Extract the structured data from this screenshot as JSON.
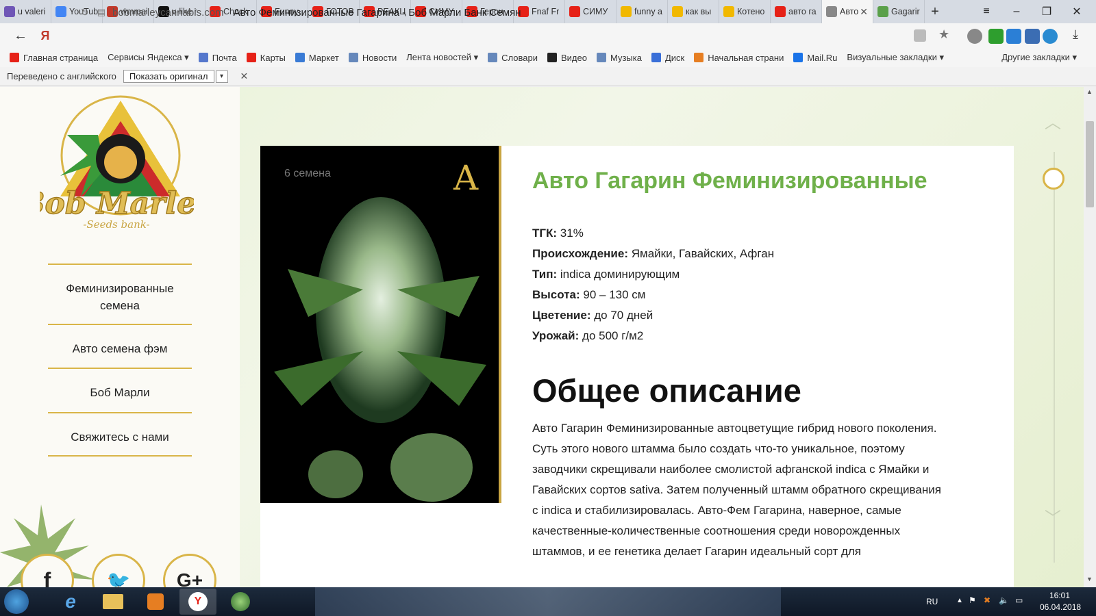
{
  "tabs": [
    {
      "label": "u valeri",
      "color": "#6f56b6"
    },
    {
      "label": "YouTub",
      "color": "#4285f4"
    },
    {
      "label": "wmmai",
      "color": "#c0392b"
    },
    {
      "label": "v-like.r",
      "color": "#111111"
    },
    {
      "label": "Chuck",
      "color": "#e62117"
    },
    {
      "label": "Funny",
      "color": "#e62117"
    },
    {
      "label": "ГОТОВ",
      "color": "#e62117"
    },
    {
      "label": "РЕАКЦ",
      "color": "#e62117"
    },
    {
      "label": "СИМУ",
      "color": "#e62117"
    },
    {
      "label": "Герои",
      "color": "#e62117"
    },
    {
      "label": "Fnaf Fr",
      "color": "#e62117"
    },
    {
      "label": "СИМУ",
      "color": "#e62117"
    },
    {
      "label": "funny a",
      "color": "#f1b800"
    },
    {
      "label": "как вы",
      "color": "#f1b800"
    },
    {
      "label": "Котено",
      "color": "#f1b800"
    },
    {
      "label": "авто га",
      "color": "#e62117"
    },
    {
      "label": "Авто",
      "color": "#888888",
      "active": true
    },
    {
      "label": "Gagarir",
      "color": "#5aa04a"
    }
  ],
  "address": {
    "domain": "bobmarleycannabis.com",
    "title": "Авто Феминизированные Гагарина - Боб Марли Банк Семян"
  },
  "bookmarks": [
    {
      "label": "Главная страница",
      "color": "#e62117"
    },
    {
      "label": "Сервисы Яндекса ▾",
      "color": "#f5f5f5"
    },
    {
      "label": "Почта",
      "color": "#5577cc"
    },
    {
      "label": "Карты",
      "color": "#e62117"
    },
    {
      "label": "Маркет",
      "color": "#3a7bd5"
    },
    {
      "label": "Новости",
      "color": "#6688bb"
    },
    {
      "label": "Лента новостей ▾",
      "color": "#f5f5f5"
    },
    {
      "label": "Словари",
      "color": "#6688bb"
    },
    {
      "label": "Видео",
      "color": "#222222"
    },
    {
      "label": "Музыка",
      "color": "#6688bb"
    },
    {
      "label": "Диск",
      "color": "#3a6fd8"
    },
    {
      "label": "Начальная страни",
      "color": "#e67e22"
    },
    {
      "label": "Mail.Ru",
      "color": "#1a73e8"
    },
    {
      "label": "Визуальные закладки ▾",
      "color": "#f5f5f5"
    }
  ],
  "bookmarks_other": "Другие закладки ▾",
  "translate": {
    "text": "Переведено с английского",
    "button": "Показать оригинал"
  },
  "sidebar": {
    "nav": [
      {
        "label": "Феминизированные семена"
      },
      {
        "label": "Авто семена фэм"
      },
      {
        "label": "Боб Марли"
      },
      {
        "label": "Свяжитесь с нами"
      }
    ],
    "social": [
      "f",
      "🐦",
      "G+"
    ]
  },
  "product": {
    "seeds_label": "6 семена",
    "title": "Авто Гагарин Феминизированные",
    "specs": [
      {
        "key": "ТГК:",
        "value": "31%"
      },
      {
        "key": "Происхождение:",
        "value": "Ямайки, Гавайских, Афган"
      },
      {
        "key": "Тип:",
        "value": "indica доминирующим"
      },
      {
        "key": "Высота:",
        "value": "90 – 130 см"
      },
      {
        "key": "Цветение:",
        "value": "до 70 дней"
      },
      {
        "key": "Урожай:",
        "value": "до 500 г/м2"
      }
    ],
    "description_title": "Общее описание",
    "description": "Авто Гагарин Феминизированные автоцветущие гибрид нового поколения. Суть этого нового штамма было создать что-то уникальное, поэтому заводчики скрещивали наиболее смолистой афганской indica с Ямайки и Гавайских сортов sativa. Затем полученный штамм обратного скрещивания с indica и стабилизировалась. Авто-Фем Гагарина, наверное, самые качественные-количественные соотношения среди новорожденных штаммов, и ее генетика делает Гагарин идеальный сорт для"
  },
  "taskbar": {
    "lang": "RU",
    "time": "16:01",
    "date": "06.04.2018"
  }
}
